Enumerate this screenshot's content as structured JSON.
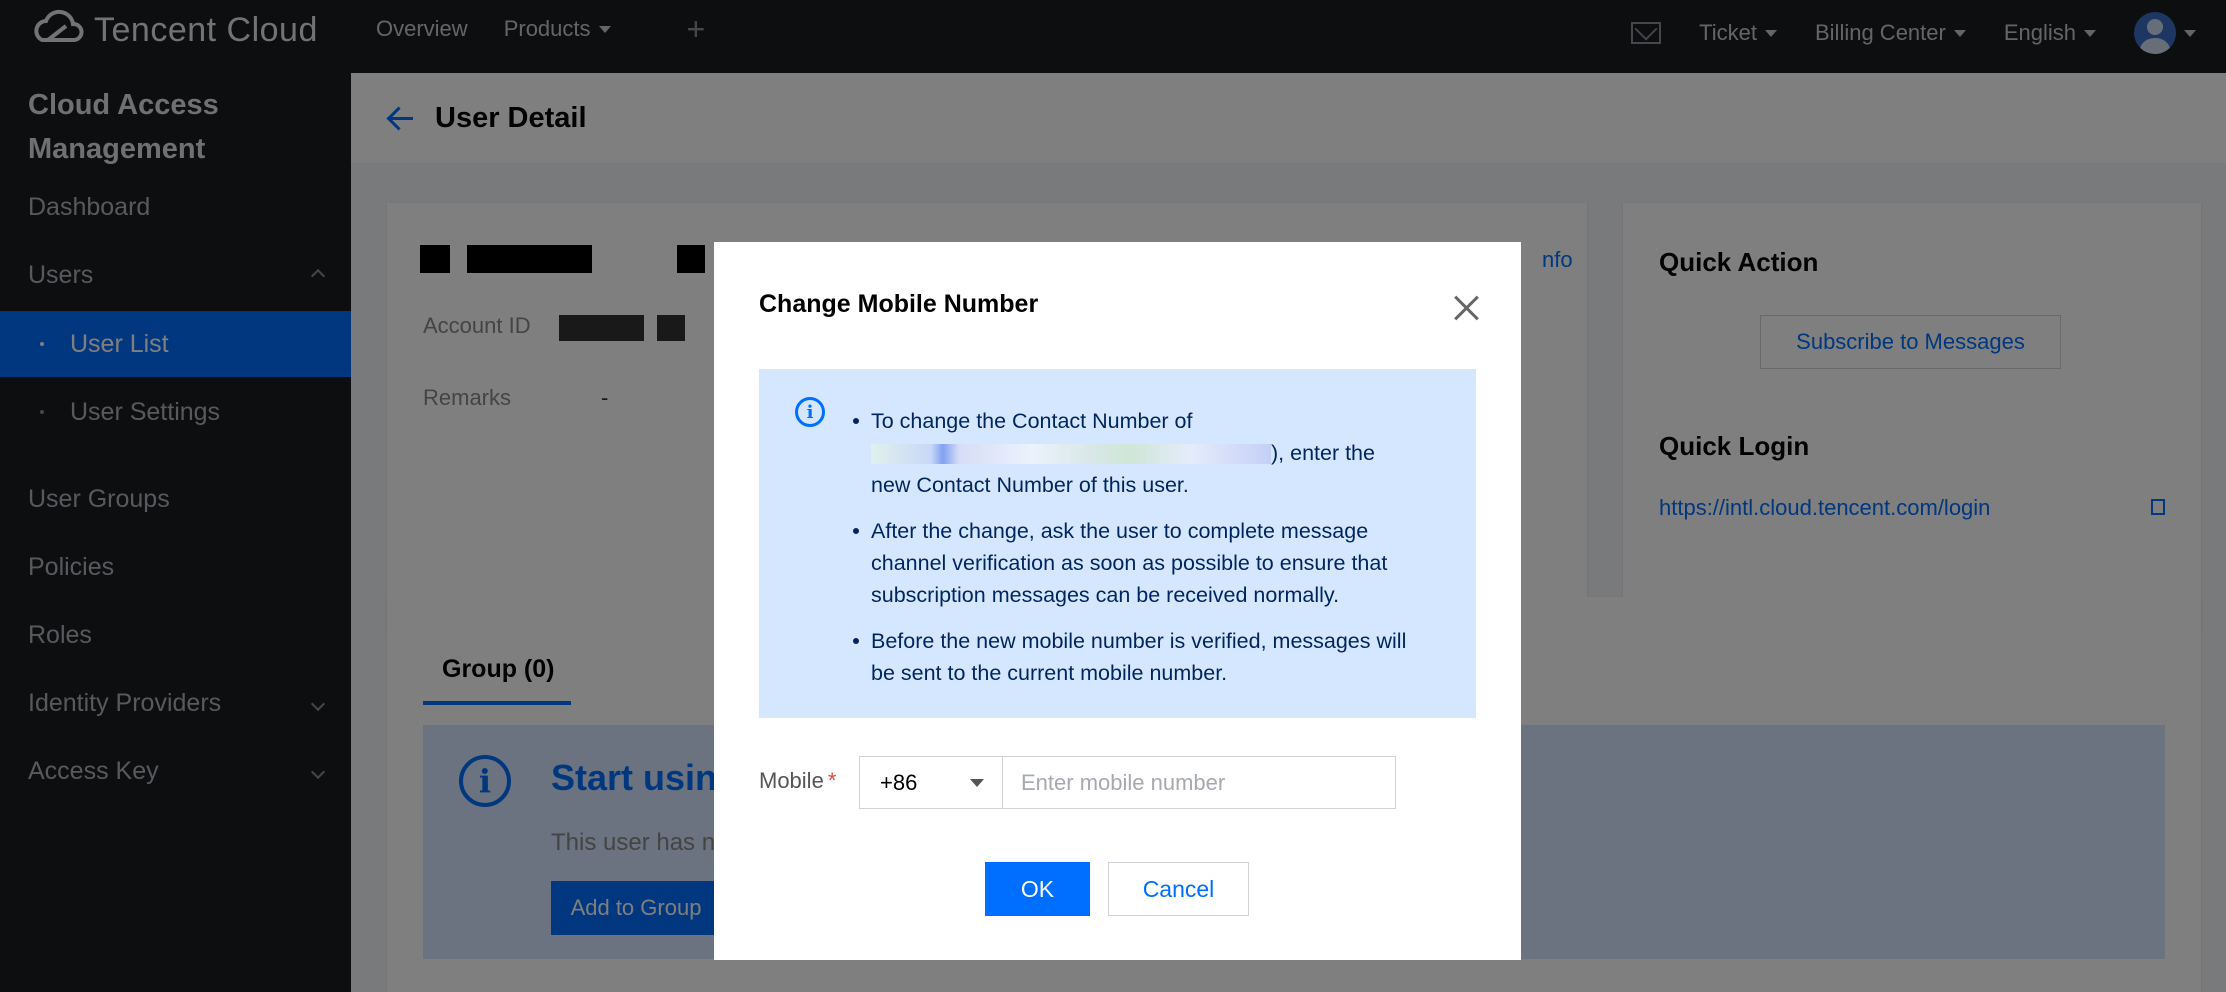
{
  "topbar": {
    "logo_text": "Tencent Cloud",
    "nav": [
      "Overview",
      "Products"
    ],
    "right": {
      "ticket": "Ticket",
      "billing": "Billing Center",
      "language": "English"
    }
  },
  "sidebar": {
    "title_line1": "Cloud Access",
    "title_line2": "Management",
    "dashboard": "Dashboard",
    "users": "Users",
    "user_list": "User List",
    "user_settings": "User Settings",
    "user_groups": "User Groups",
    "policies": "Policies",
    "roles": "Roles",
    "identity_providers": "Identity Providers",
    "access_key": "Access Key"
  },
  "page": {
    "title": "User Detail",
    "account_id_label": "Account ID",
    "remarks_label": "Remarks",
    "remarks_value": "-",
    "info_link_fragment": "nfo",
    "quick_action_title": "Quick Action",
    "subscribe_button": "Subscribe to Messages",
    "quick_login_title": "Quick Login",
    "quick_login_url": "https://intl.cloud.tencent.com/login",
    "group_tab": "Group  (0)",
    "start_text": "Start usin",
    "user_has_text": "This user has n",
    "add_to_group": "Add to Group"
  },
  "modal": {
    "title": "Change Mobile Number",
    "bullet1_part1": "To change the Contact Number of",
    "bullet1_part2": "), enter the",
    "bullet1_part3": "new Contact Number of this user.",
    "bullet2": "After the change, ask the user to complete message channel verification as soon as possible to ensure that subscription messages can be received normally.",
    "bullet3": "Before the new mobile number is verified, messages will be sent to the current mobile number.",
    "mobile_label": "Mobile",
    "country_code": "+86",
    "mobile_placeholder": "Enter mobile number",
    "ok": "OK",
    "cancel": "Cancel"
  },
  "colors": {
    "primary": "#006eff",
    "topbar": "#181c21",
    "info_bg": "#d5e7ff"
  }
}
